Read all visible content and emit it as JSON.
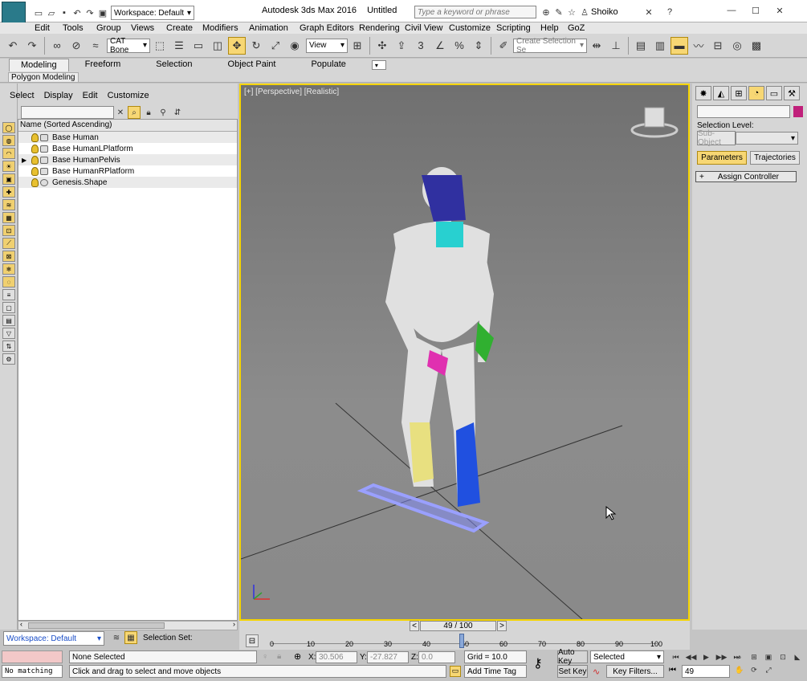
{
  "title": {
    "app": "Autodesk 3ds Max 2016",
    "doc": "Untitled",
    "workspace": "Workspace: Default",
    "search_placeholder": "Type a keyword or phrase",
    "user": "Shoiko"
  },
  "menu": [
    "Edit",
    "Tools",
    "Group",
    "Views",
    "Create",
    "Modifiers",
    "Animation",
    "Graph Editors",
    "Rendering",
    "Civil View",
    "Customize",
    "Scripting",
    "Help",
    "GoZ"
  ],
  "toolbar": {
    "selection_filter": "CAT Bone",
    "ref_coord": "View",
    "named_selection_placeholder": "Create Selection Se"
  },
  "ribbon": {
    "tabs": [
      "Modeling",
      "Freeform",
      "Selection",
      "Object Paint",
      "Populate"
    ],
    "panel": "Polygon Modeling"
  },
  "explorer": {
    "menu": [
      "Select",
      "Display",
      "Edit",
      "Customize"
    ],
    "header": "Name (Sorted Ascending)",
    "items": [
      {
        "name": "Base Human"
      },
      {
        "name": "Base HumanLPlatform"
      },
      {
        "name": "Base HumanPelvis"
      },
      {
        "name": "Base HumanRPlatform"
      },
      {
        "name": "Genesis.Shape"
      }
    ]
  },
  "viewport": {
    "label": "[+] [Perspective] [Realistic]"
  },
  "cmdpanel": {
    "selection_level": "Selection Level:",
    "sub_object": "Sub-Object",
    "parameters": "Parameters",
    "trajectories": "Trajectories",
    "assign_controller": "Assign Controller"
  },
  "timeline": {
    "frame": "49 / 100",
    "ticks": [
      "0",
      "10",
      "20",
      "30",
      "40",
      "50",
      "60",
      "70",
      "80",
      "90",
      "100"
    ],
    "current": 49,
    "max": 100
  },
  "status": {
    "workspace": "Workspace: Default",
    "selection_set": "Selection Set:",
    "no_matching": "No matching",
    "none_selected": "None Selected",
    "hint": "Click and drag to select and move objects",
    "x_label": "X:",
    "x": "30.506",
    "y_label": "Y:",
    "y": "-27.827",
    "z_label": "Z:",
    "z": "0.0",
    "grid": "Grid = 10.0",
    "add_time_tag": "Add Time Tag",
    "auto_key": "Auto Key",
    "set_key": "Set Key",
    "key_mode": "Selected",
    "key_filters": "Key Filters...",
    "frame_field": "49"
  },
  "colors": {
    "accent": "#f5d400",
    "active": "#f7d774"
  }
}
